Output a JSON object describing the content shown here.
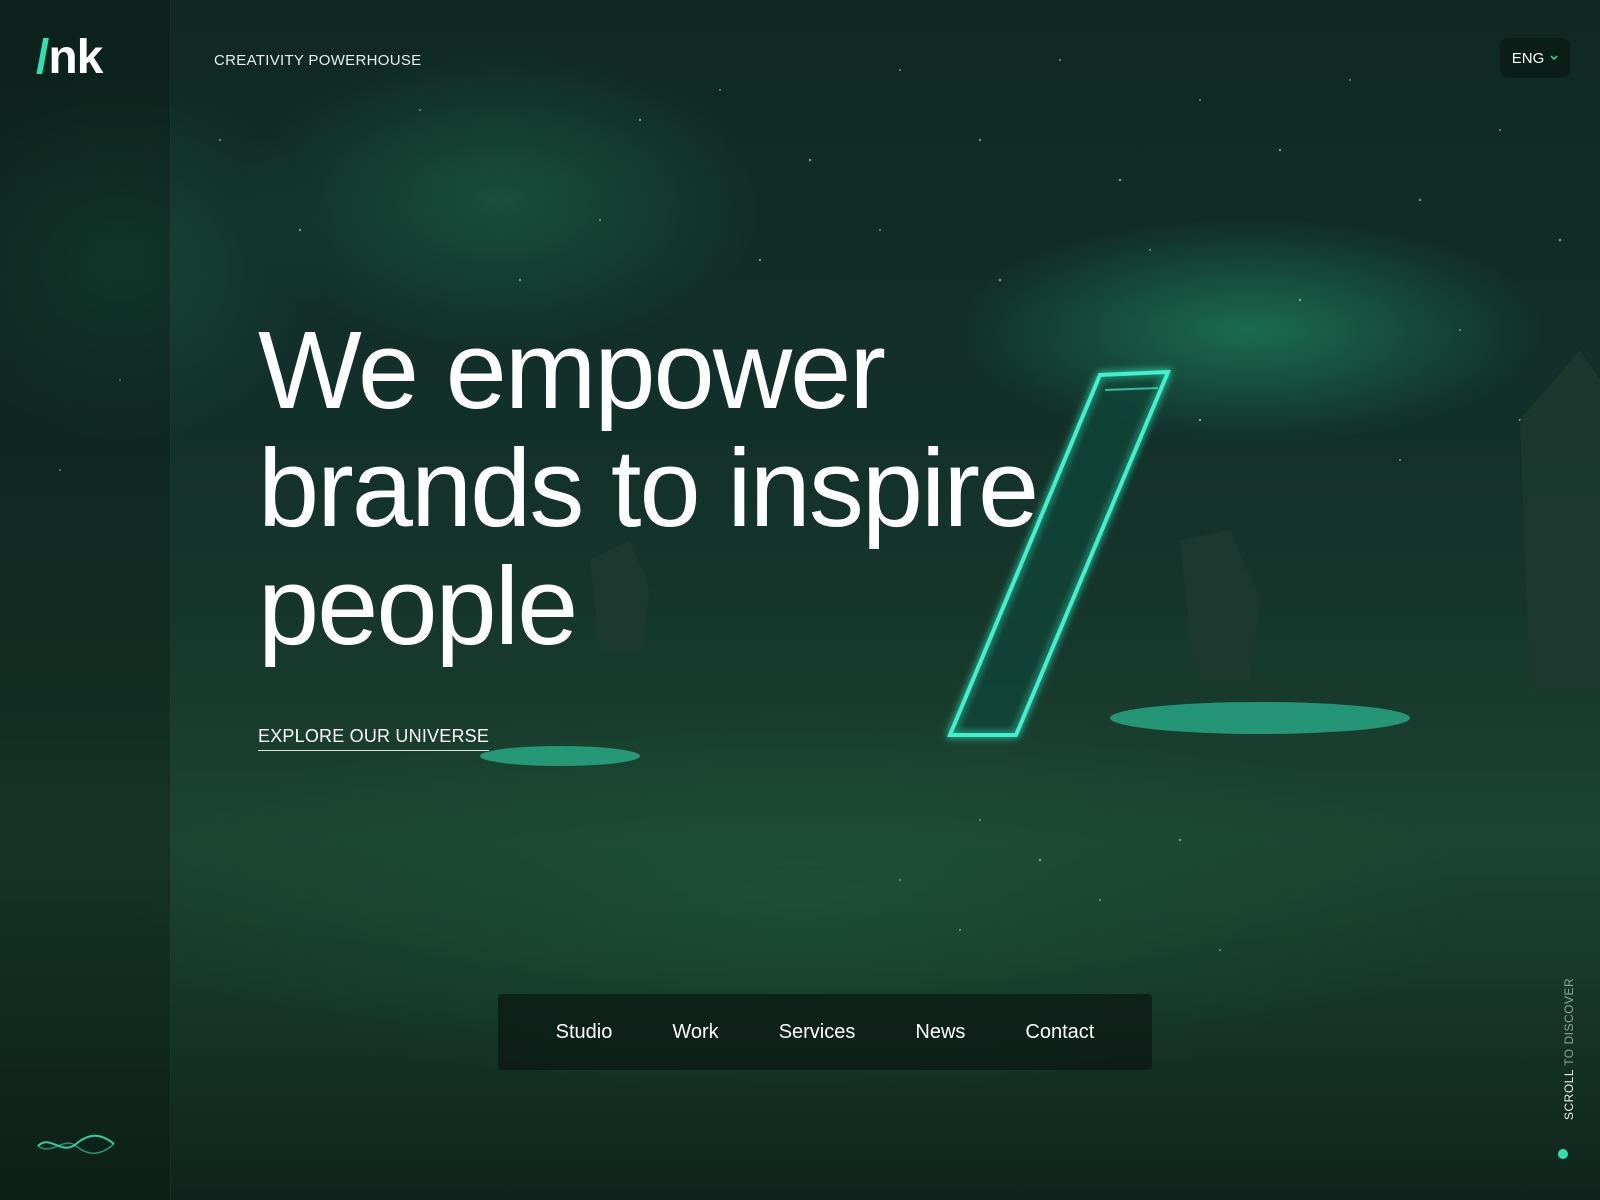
{
  "brand": {
    "logo_slash": "/",
    "logo_text": "nk",
    "tagline": "CREATIVITY POWERHOUSE"
  },
  "language": {
    "selected": "ENG"
  },
  "hero": {
    "headline_lines": [
      "We empower",
      "brands to inspire",
      "people"
    ],
    "cta_label": "EXPLORE OUR UNIVERSE"
  },
  "nav": {
    "items": [
      "Studio",
      "Work",
      "Services",
      "News",
      "Contact"
    ]
  },
  "scroll_hint": {
    "strong": "SCROLL",
    "soft": " TO DISCOVER"
  },
  "icons": {
    "language_chevron": "chevron-down-icon",
    "sound": "sound-wave-icon",
    "monolith": "glowing-slash-monolith"
  },
  "colors": {
    "accent": "#2fe0b0",
    "background": "#0d1a16",
    "text": "#ffffff"
  }
}
